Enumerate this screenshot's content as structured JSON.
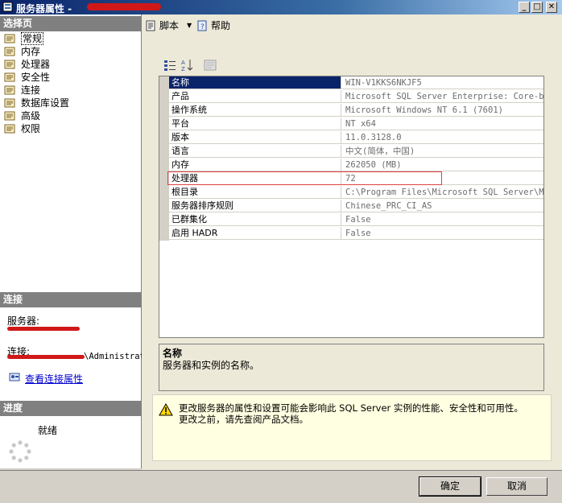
{
  "window": {
    "title": "服务器属性 -",
    "buttons": [
      "_",
      "□",
      "✕"
    ]
  },
  "left": {
    "select_page_header": "选择页",
    "pages": [
      {
        "label": "常规",
        "selected": true
      },
      {
        "label": "内存"
      },
      {
        "label": "处理器"
      },
      {
        "label": "安全性"
      },
      {
        "label": "连接"
      },
      {
        "label": "数据库设置"
      },
      {
        "label": "高级"
      },
      {
        "label": "权限"
      }
    ],
    "connection_header": "连接",
    "server_label": "服务器:",
    "connection_label": "连接:",
    "connection_user_suffix": "\\Administrat",
    "view_connection_props": "查看连接属性",
    "progress_header": "进度",
    "progress_status": "就绪"
  },
  "toolbar": {
    "script_label": "脚本",
    "help_label": "帮助"
  },
  "grid": {
    "rows": [
      {
        "name": "名称",
        "value": "WIN-V1KKS6NKJF5",
        "selected": true
      },
      {
        "name": "产品",
        "value": "Microsoft SQL Server Enterprise: Core-bas"
      },
      {
        "name": "操作系统",
        "value": "Microsoft Windows NT 6.1 (7601)"
      },
      {
        "name": "平台",
        "value": "NT x64"
      },
      {
        "name": "版本",
        "value": "11.0.3128.0"
      },
      {
        "name": "语言",
        "value": "中文(简体，中国)"
      },
      {
        "name": "内存",
        "value": "262050 (MB)"
      },
      {
        "name": "处理器",
        "value": "72",
        "highlighted": true
      },
      {
        "name": "根目录",
        "value": "C:\\Program Files\\Microsoft SQL Server\\MSS"
      },
      {
        "name": "服务器排序规则",
        "value": "Chinese_PRC_CI_AS"
      },
      {
        "name": "已群集化",
        "value": "False"
      },
      {
        "name": "启用 HADR",
        "value": "False"
      }
    ]
  },
  "description": {
    "title": "名称",
    "text": "服务器和实例的名称。"
  },
  "warning": {
    "line1": "更改服务器的属性和设置可能会影响此 SQL Server 实例的性能、安全性和可用性。",
    "line2": "更改之前，请先查阅产品文档。"
  },
  "buttons": {
    "ok": "确定",
    "cancel": "取消"
  },
  "colors": {
    "selection": "#0a246a",
    "highlight_border": "#e04040",
    "warning_bg": "#ffffe1",
    "section_header": "#808080"
  }
}
